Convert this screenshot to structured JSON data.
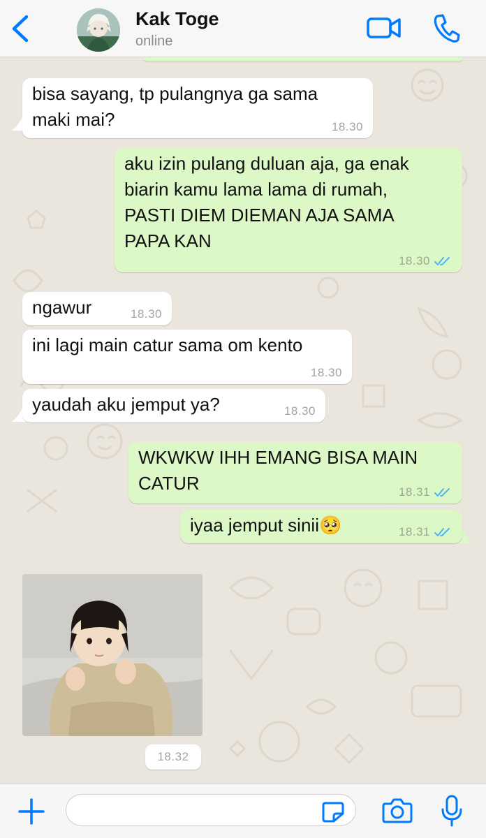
{
  "header": {
    "contact_name": "Kak Toge",
    "status": "online"
  },
  "icons": {
    "back": "chevron-left-icon",
    "video": "video-camera-icon",
    "call": "phone-icon",
    "plus": "plus-icon",
    "sticker": "sticker-icon",
    "camera": "camera-icon",
    "mic": "microphone-icon",
    "read_receipt": "double-check-icon"
  },
  "colors": {
    "accent": "#007aff",
    "outgoing_bubble": "#dcf8c6",
    "incoming_bubble": "#ffffff",
    "read_ticks": "#4fb6ec",
    "wallpaper": "#ebe6dd"
  },
  "messages": [
    {
      "direction": "in",
      "text": "bisa sayang, tp pulangnya ga sama\nmaki mai?",
      "time": "18.30"
    },
    {
      "direction": "out",
      "text": "aku izin pulang duluan aja, ga enak\nbiarin kamu lama lama di rumah,\nPASTI DIEM DIEMAN AJA SAMA\nPAPA KAN",
      "time": "18.30",
      "read": true
    },
    {
      "direction": "in",
      "text": "ngawur",
      "time": "18.30"
    },
    {
      "direction": "in",
      "text": "ini lagi main catur sama om kento",
      "time": "18.30"
    },
    {
      "direction": "in",
      "text": "yaudah aku jemput ya?",
      "time": "18.30"
    },
    {
      "direction": "out",
      "text": "WKWKW IHH EMANG BISA MAIN\nCATUR",
      "time": "18.31",
      "read": true
    },
    {
      "direction": "out",
      "text": "iyaa jemput sinii🥺",
      "time": "18.31",
      "read": true
    },
    {
      "direction": "in",
      "type": "image",
      "time": "18.32"
    }
  ],
  "composer": {
    "value": "",
    "placeholder": ""
  }
}
